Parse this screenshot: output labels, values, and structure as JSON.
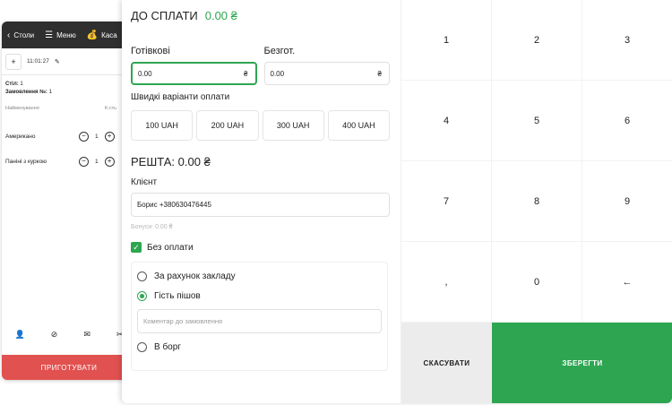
{
  "pos": {
    "nav": [
      {
        "icon": "chevron-left-icon",
        "glyph": "‹",
        "label": "Столи"
      },
      {
        "icon": "menu-icon",
        "glyph": "☰",
        "label": "Меню"
      },
      {
        "icon": "money-bag-icon",
        "glyph": "💰",
        "label": "Каса"
      }
    ],
    "add_glyph": "+",
    "time": "11:01:27",
    "table_label": "Стіл:",
    "table_value": "1",
    "order_label": "Замовлення №:",
    "order_value": "1",
    "col_name": "Найменування",
    "col_qty": "К-сть",
    "items": [
      {
        "name": "Американо",
        "qty": "1"
      },
      {
        "name": "Паніні з куркою",
        "qty": "1"
      }
    ],
    "cook_button": "ПРИГОТУВАТИ"
  },
  "payment": {
    "title": "ДО СПЛАТИ",
    "total": "0.00 ₴",
    "cash_label": "Готівкові",
    "cash_value": "0.00",
    "card_label": "Безгот.",
    "card_value": "0.00",
    "currency": "₴",
    "quick_label": "Швидкі варіанти оплати",
    "quick_options": [
      "100 UAH",
      "200 UAH",
      "300 UAH",
      "400 UAH"
    ],
    "change": "РЕШТА: 0.00 ₴",
    "client_label": "Клієнт",
    "client_value": "Борис +380630476445",
    "bonus": "Бонуси: 0.00 ₴",
    "no_payment_label": "Без оплати",
    "option_establishment": "За рахунок закладу",
    "option_guest_left": "Гість пішов",
    "comment_placeholder": "Коментар до замовлення",
    "option_debt": "В борг"
  },
  "numpad": {
    "keys": [
      "1",
      "2",
      "3",
      "4",
      "5",
      "6",
      "7",
      "8",
      "9",
      ",",
      "0",
      "←"
    ],
    "cancel": "СКАСУВАТИ",
    "save": "ЗБЕРЕГТИ"
  },
  "colors": {
    "accent": "#2ea651",
    "danger": "#e15150",
    "topbar": "#2f2f2f"
  }
}
